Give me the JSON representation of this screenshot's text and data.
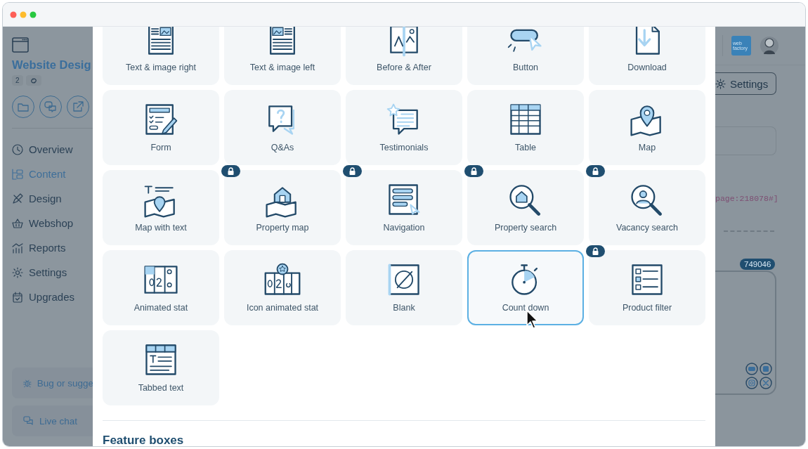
{
  "sidebar": {
    "title": "Website Desig",
    "count": "2",
    "nav": [
      {
        "label": "Overview",
        "selected": false
      },
      {
        "label": "Content",
        "selected": true
      },
      {
        "label": "Design",
        "selected": false
      },
      {
        "label": "Webshop",
        "selected": false
      },
      {
        "label": "Reports",
        "selected": false
      },
      {
        "label": "Settings",
        "selected": false
      },
      {
        "label": "Upgrades",
        "selected": false
      }
    ],
    "footer": [
      "Bug or sugge",
      "Live chat"
    ]
  },
  "panel": {
    "logo_text": "web factory",
    "settings_button": "Settings",
    "code": "page:218078#]",
    "badge": "749046"
  },
  "modal": {
    "blocks": [
      {
        "label": "Text & image right",
        "locked": false,
        "selected": false
      },
      {
        "label": "Text & image left",
        "locked": false,
        "selected": false
      },
      {
        "label": "Before & After",
        "locked": false,
        "selected": false
      },
      {
        "label": "Button",
        "locked": false,
        "selected": false
      },
      {
        "label": "Download",
        "locked": false,
        "selected": false
      },
      {
        "label": "Form",
        "locked": false,
        "selected": false
      },
      {
        "label": "Q&As",
        "locked": false,
        "selected": false
      },
      {
        "label": "Testimonials",
        "locked": false,
        "selected": false
      },
      {
        "label": "Table",
        "locked": false,
        "selected": false
      },
      {
        "label": "Map",
        "locked": false,
        "selected": false
      },
      {
        "label": "Map with text",
        "locked": false,
        "selected": false
      },
      {
        "label": "Property map",
        "locked": true,
        "selected": false
      },
      {
        "label": "Navigation",
        "locked": true,
        "selected": false
      },
      {
        "label": "Property search",
        "locked": true,
        "selected": false
      },
      {
        "label": "Vacancy search",
        "locked": true,
        "selected": false
      },
      {
        "label": "Animated stat",
        "locked": false,
        "selected": false
      },
      {
        "label": "Icon animated stat",
        "locked": false,
        "selected": false
      },
      {
        "label": "Blank",
        "locked": false,
        "selected": false
      },
      {
        "label": "Count down",
        "locked": false,
        "selected": true
      },
      {
        "label": "Product filter",
        "locked": true,
        "selected": false
      },
      {
        "label": "Tabbed text",
        "locked": false,
        "selected": false
      }
    ],
    "section_title": "Feature boxes"
  }
}
